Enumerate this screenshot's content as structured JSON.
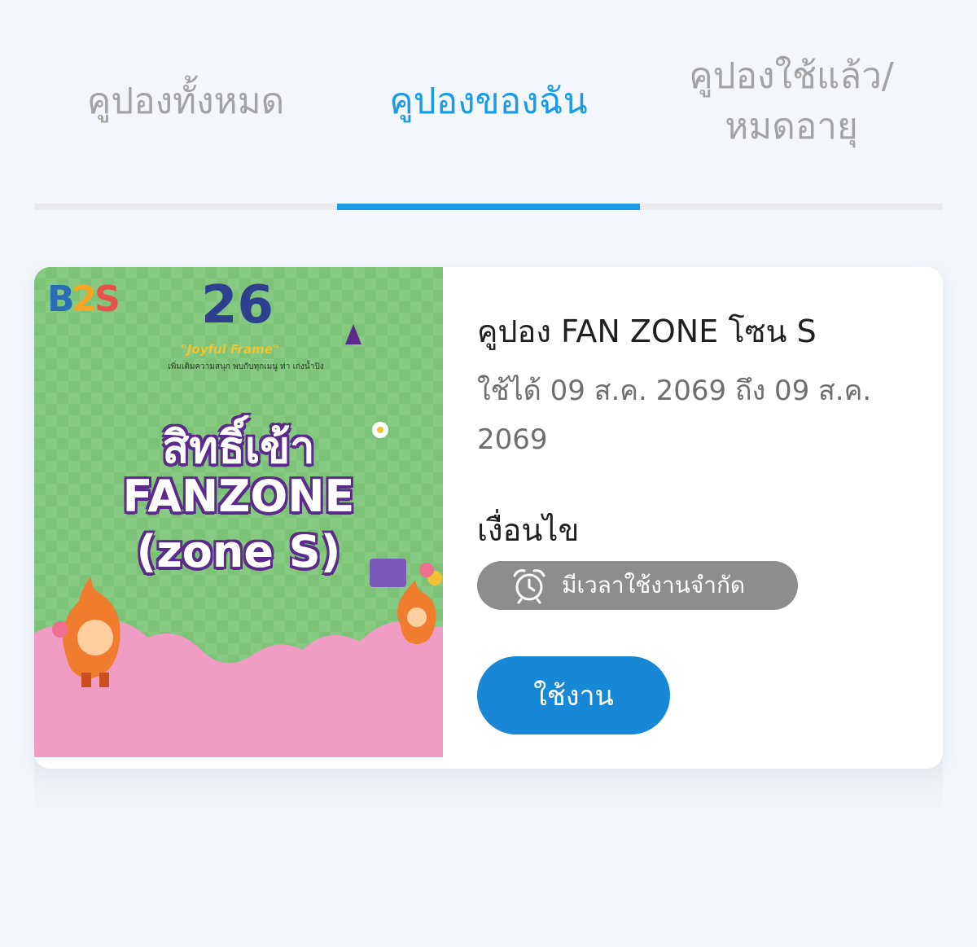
{
  "tabs": [
    {
      "label": "คูปองทั้งหมด",
      "active": false
    },
    {
      "label": "คูปองของฉัน",
      "active": true
    },
    {
      "label_line1": "คูปองใช้แล้ว/",
      "label_line2": "หมดอายุ",
      "active": false
    }
  ],
  "coupon": {
    "image": {
      "logo": {
        "b": "B",
        "two": "2",
        "s": "S"
      },
      "anniversary": "26",
      "event_name": "\"Joyful Frame\"",
      "event_subtitle": "เพิ่มเติมความสนุก พบกับทุกเมนู ท่า เก่งน้ำปิง",
      "title_line1": "สิทธิ์เข้า",
      "title_line2": "FANZONE",
      "title_line3": "(zone S)"
    },
    "title": "คูปอง FAN ZONE โซน S",
    "validity": "ใช้ได้ 09 ส.ค. 2069 ถึง 09 ส.ค. 2069",
    "condition_label": "เงื่อนไข",
    "condition_badge": "มีเวลาใช้งานจำกัด",
    "use_button": "ใช้งาน"
  },
  "colors": {
    "accent": "#1a9be8",
    "button": "#1888d6",
    "badge": "#8d8d8d",
    "background": "#f3f7fc"
  },
  "icons": {
    "badge_icon": "alarm-clock-icon"
  }
}
